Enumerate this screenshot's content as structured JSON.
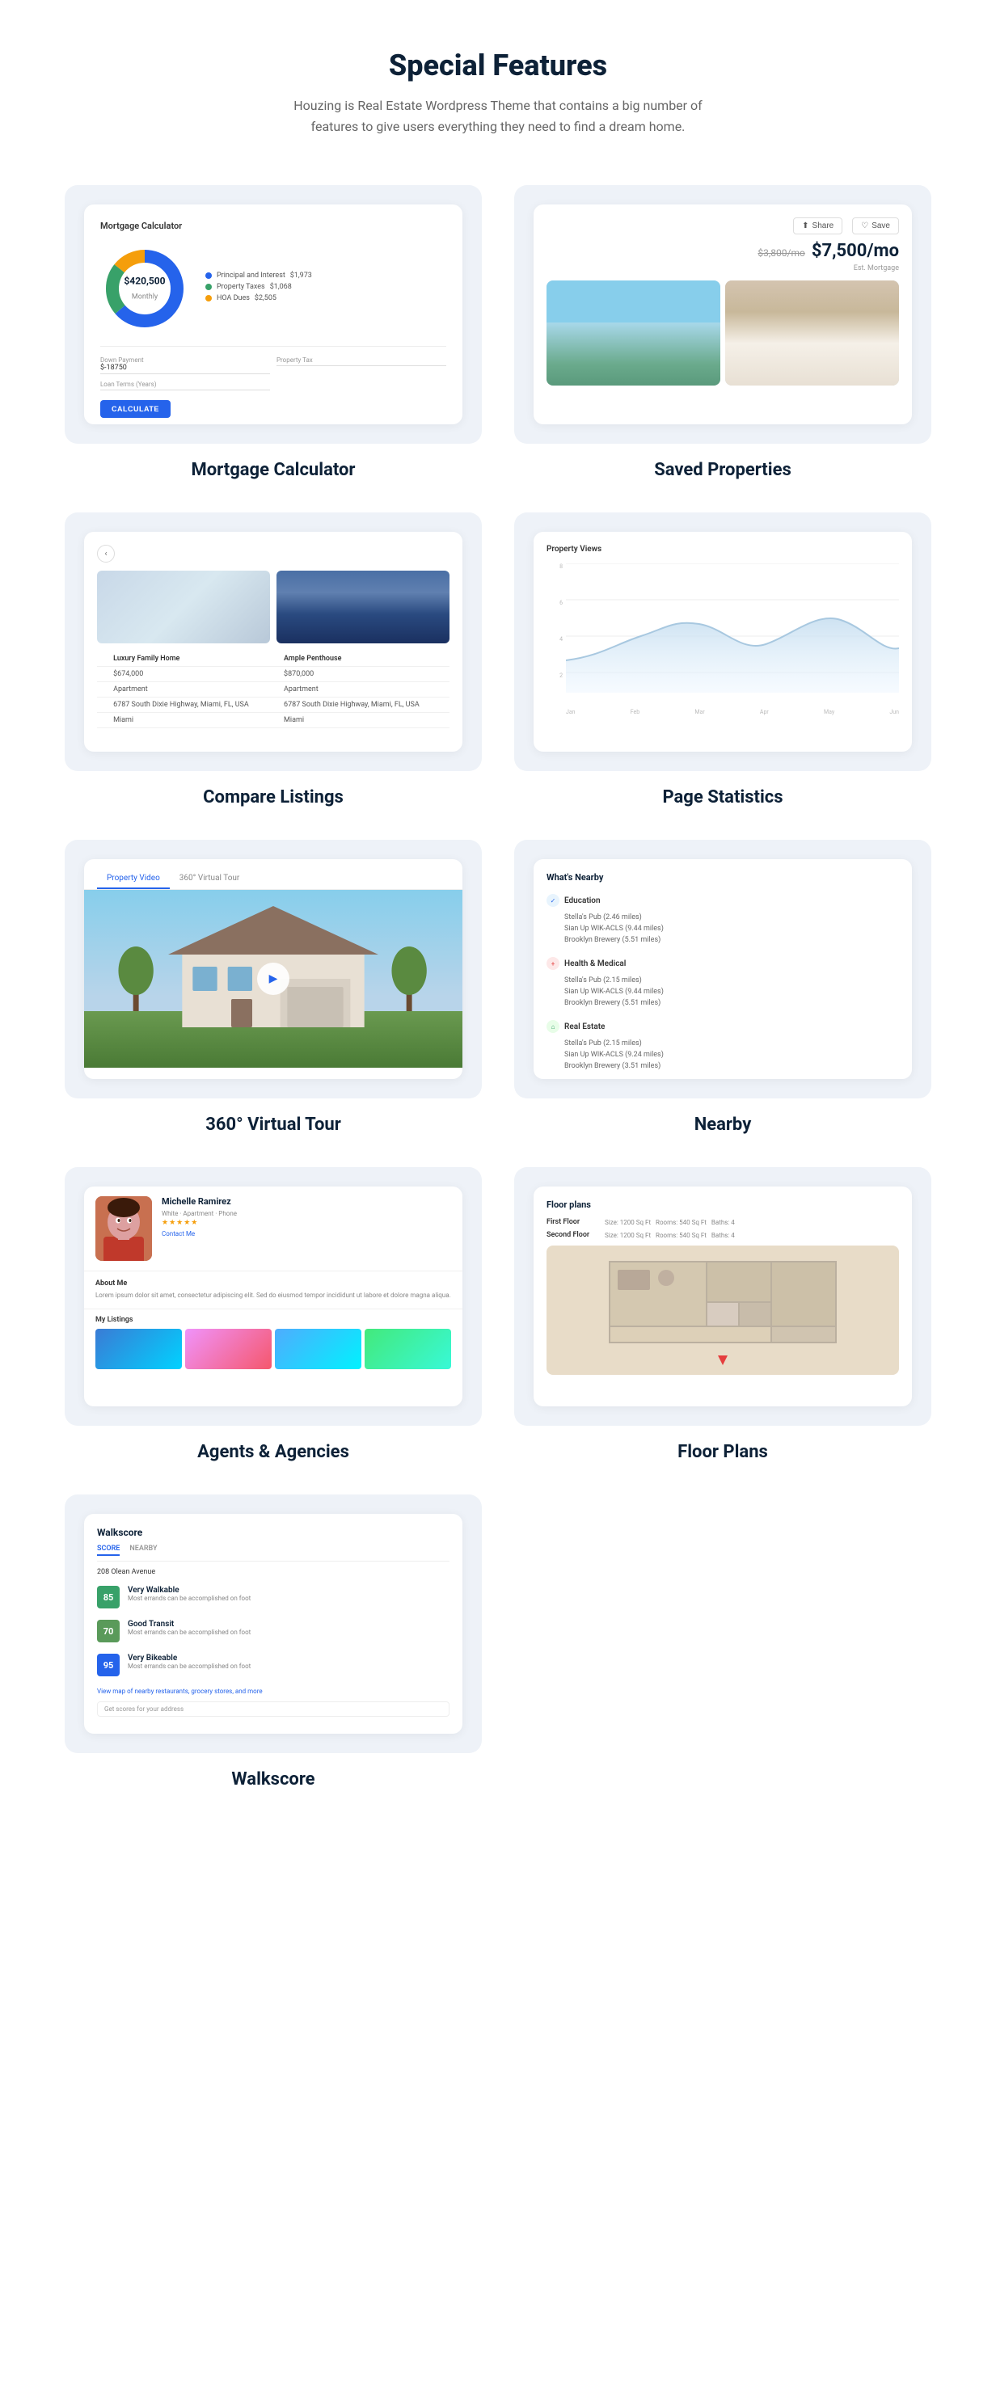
{
  "page": {
    "title": "Special Features",
    "subtitle": "Houzing is Real Estate Wordpress Theme that contains a big number of features to give users everything they need to find a dream home."
  },
  "features": [
    {
      "id": "mortgage-calculator",
      "title": "Mortgage Calculator",
      "card": {
        "section_title": "Mortgage Calculator",
        "amount": "$420,500",
        "period": "Monthly",
        "legend": [
          {
            "label": "Principal and Interest",
            "value": "$1,973",
            "color": "#2563eb"
          },
          {
            "label": "Property Taxes",
            "value": "$1,068",
            "color": "#38a169"
          },
          {
            "label": "HOA Dues",
            "value": "$2,505",
            "color": "#f59e0b"
          }
        ],
        "down_payment_label": "Down Payment",
        "down_payment_value": "$-18750",
        "loan_term_label": "Loan Terms (Years)",
        "property_tax_label": "Property Tax",
        "button_label": "CALCULATE"
      }
    },
    {
      "id": "saved-properties",
      "title": "Saved Properties",
      "card": {
        "share_label": "Share",
        "save_label": "Save",
        "old_price": "$3,800/mo",
        "new_price": "$7,500/mo",
        "est_label": "Est. Mortgage"
      }
    },
    {
      "id": "compare-listings",
      "title": "Compare Listings",
      "card": {
        "nav_prev": "‹",
        "nav_next": "›",
        "listings": [
          {
            "name": "Luxury Family Home",
            "price": "$674,000",
            "type": "Apartment",
            "address": "6787 South Dixie Highway, Miami, FL, USA",
            "city": "Miami"
          },
          {
            "name": "Ample Penthouse",
            "price": "$870,000",
            "type": "Apartment",
            "address": "6787 South Dixie Highway, Miami, FL, USA",
            "city": "Miami"
          }
        ]
      }
    },
    {
      "id": "page-statistics",
      "title": "Page Statistics",
      "card": {
        "chart_title": "Property Views",
        "y_labels": [
          "8",
          "6",
          "4",
          "2",
          ""
        ],
        "x_labels": [
          "Jan",
          "Feb",
          "Mar",
          "Apr",
          "May",
          "Jun"
        ]
      }
    },
    {
      "id": "virtual-tour",
      "title": "360° Virtual Tour",
      "card": {
        "tab1": "Property Video",
        "tab2": "360° Virtual Tour",
        "play_icon": "▶"
      }
    },
    {
      "id": "nearby",
      "title": "Nearby",
      "card": {
        "title": "What's Nearby",
        "categories": [
          {
            "name": "Education",
            "icon": "🎓",
            "places": [
              "Stella's Pub (2.46 miles)",
              "Sian Up WIK-ACLS (9.44 miles)",
              "Brooklyn Brewery (5.51 miles)"
            ]
          },
          {
            "name": "Health & Medical",
            "icon": "💊",
            "places": [
              "Stella's Pub (2.15 miles)",
              "Sian Up WIK-ACLS (9.44 miles)",
              "Brooklyn Brewery (5.51 miles)"
            ]
          },
          {
            "name": "Real Estate",
            "icon": "🏠",
            "places": [
              "Stella's Pub (2.15 miles)",
              "Sian Up WIK-ACLS (9.24 miles)",
              "Brooklyn Brewery (3.51 miles)"
            ]
          }
        ]
      }
    },
    {
      "id": "agents-agencies",
      "title": "Agents & Agencies",
      "card": {
        "agent_name": "Michelle Ramirez",
        "agent_details": [
          "White",
          "Apartment",
          "Phone"
        ],
        "stars": "★★★★★",
        "contact_label": "Contact Me",
        "about_title": "About Me",
        "about_text": "Lorem ipsum dolor sit amet, consectetur adipiscing elit. Sed do eiusmod tempor incididunt ut labore et dolore magna aliqua.",
        "listings_title": "My Listings"
      }
    },
    {
      "id": "floor-plans",
      "title": "Floor Plans",
      "card": {
        "title": "Floor plans",
        "first_floor": {
          "label": "First Floor",
          "size": "Size: 1200 Sq Ft",
          "rooms": "Rooms: 540 Sq Ft",
          "baths": "Baths: 4"
        },
        "second_floor": {
          "label": "Second Floor",
          "size": "Size: 1200 Sq Ft",
          "rooms": "Rooms: 540 Sq Ft",
          "baths": "Baths: 4"
        }
      }
    },
    {
      "id": "walkscore",
      "title": "Walkscore",
      "card": {
        "header": "Walkscore",
        "tab_score": "SCORE",
        "tab_nearby": "NEARBY",
        "address": "208 Olean Avenue",
        "scores": [
          {
            "score": "85",
            "label": "Very Walkable",
            "description": "Most errands can be accomplished on foot",
            "color_class": "walk-score-75"
          },
          {
            "score": "70",
            "label": "Good Transit",
            "description": "Most errands can be accomplished on foot",
            "color_class": "walk-score-75"
          },
          {
            "score": "95",
            "label": "Very Bikeable",
            "description": "Most errands can be accomplished on foot",
            "color_class": "walk-score-95"
          }
        ],
        "map_link": "View map of nearby restaurants, grocery stores, and more",
        "address_input_placeholder": "Get scores for your address"
      }
    }
  ]
}
